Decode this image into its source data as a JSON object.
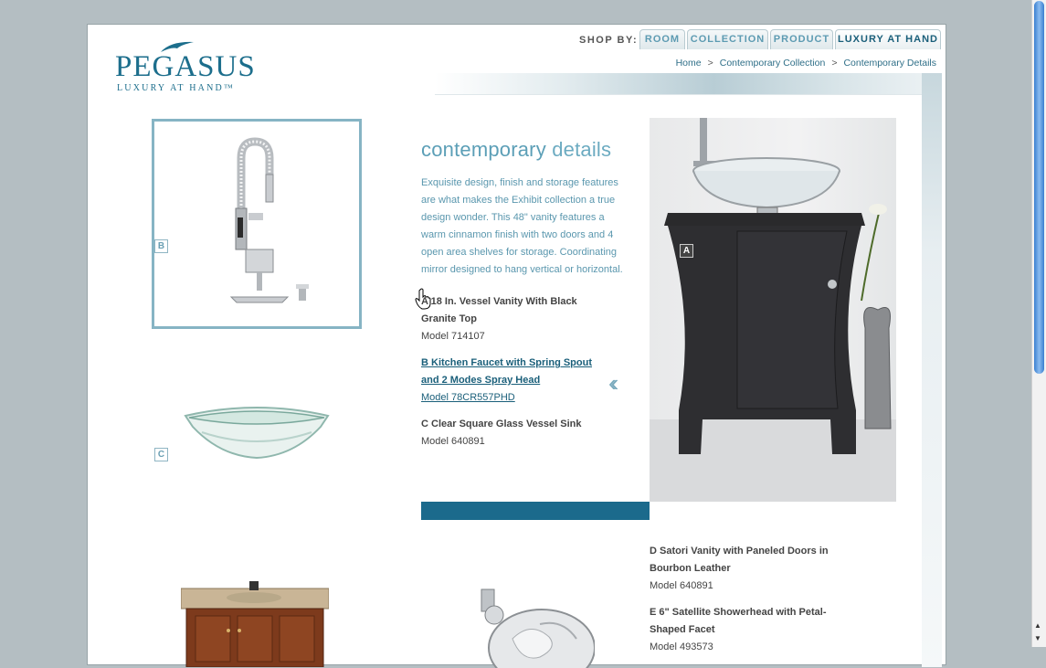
{
  "brand": {
    "name": "PEGASUS",
    "tagline": "LUXURY AT HAND™"
  },
  "nav": {
    "shop_by": "SHOP BY:",
    "tabs": [
      {
        "label": "ROOM"
      },
      {
        "label": "COLLECTION"
      },
      {
        "label": "PRODUCT"
      },
      {
        "label": "LUXURY AT HAND"
      }
    ]
  },
  "breadcrumb": {
    "home": "Home",
    "collection": "Contemporary Collection",
    "current": "Contemporary Details",
    "separator": ">"
  },
  "content": {
    "heading_bold": "contemporary",
    "heading_light": "details",
    "description": "Exquisite design, finish and storage features are what makes the Exhibit collection a true design wonder. This 48\" vanity features a warm cinnamon finish with two doors and 4 open area shelves for storage. Coordinating mirror designed to hang vertical or horizontal.",
    "items": [
      {
        "title": "A 18 In. Vessel Vanity With Black Granite Top",
        "model": "Model 714107"
      },
      {
        "title": "B Kitchen Faucet with Spring Spout and 2 Modes Spray Head",
        "model": "Model 78CR557PHD"
      },
      {
        "title": "C Clear Square Glass Vessel Sink",
        "model": "Model 640891"
      }
    ],
    "items2": [
      {
        "title": "D Satori Vanity with Paneled Doors in Bourbon Leather",
        "model": "Model 640891"
      },
      {
        "title": "E 6\" Satellite Showerhead with Petal-Shaped Facet",
        "model": "Model 493573"
      }
    ]
  },
  "labels": {
    "a": "A",
    "b": "B",
    "c": "C"
  },
  "colors": {
    "accent": "#1b6a8c",
    "light_accent": "#5c9fb7",
    "frame": "#86b4c4"
  }
}
